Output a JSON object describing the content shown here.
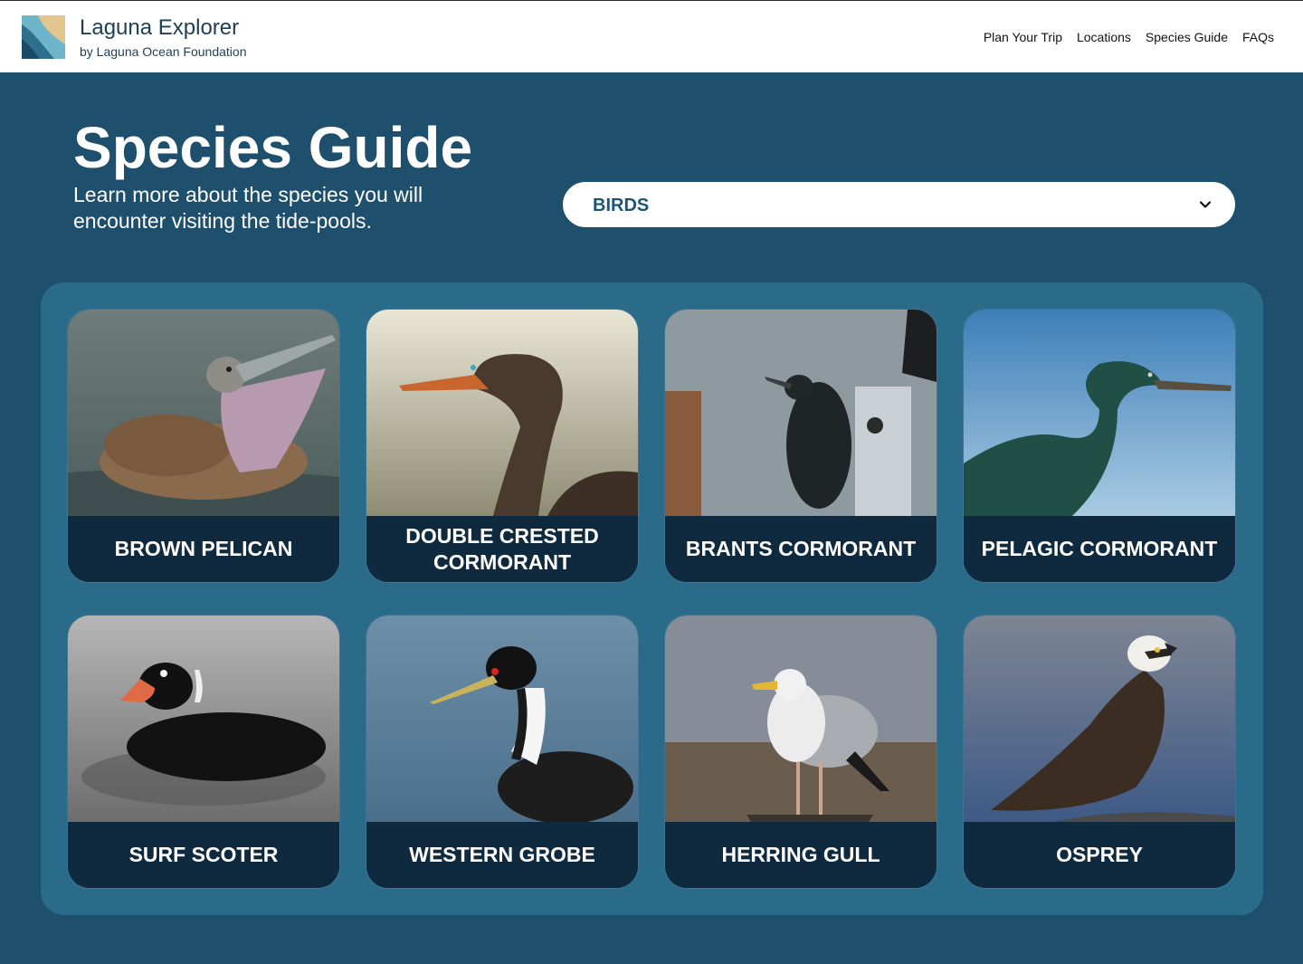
{
  "brand": {
    "title": "Laguna Explorer",
    "subtitle": "by Laguna Ocean Foundation"
  },
  "nav": {
    "items": [
      {
        "label": "Plan Your Trip"
      },
      {
        "label": "Locations"
      },
      {
        "label": "Species Guide"
      },
      {
        "label": "FAQs"
      }
    ]
  },
  "hero": {
    "title": "Species Guide",
    "subtitle": "Learn more about the species you will encounter visiting the tide-pools."
  },
  "filter": {
    "selected": "BIRDS"
  },
  "colors": {
    "background": "#1e4f6d",
    "panel": "#2b6b8a",
    "card_label": "#0f2a3f",
    "dropdown_text": "#1e5474"
  },
  "species": [
    {
      "name": "BROWN PELICAN",
      "icon": "pelican-photo"
    },
    {
      "name": "DOUBLE CRESTED CORMORANT",
      "icon": "cormorant-photo"
    },
    {
      "name": "BRANTS CORMORANT",
      "icon": "cormorant-photo"
    },
    {
      "name": "PELAGIC CORMORANT",
      "icon": "cormorant-photo"
    },
    {
      "name": "SURF SCOTER",
      "icon": "duck-photo"
    },
    {
      "name": "WESTERN GROBE",
      "icon": "grebe-photo"
    },
    {
      "name": "HERRING GULL",
      "icon": "gull-photo"
    },
    {
      "name": "OSPREY",
      "icon": "osprey-photo"
    }
  ]
}
